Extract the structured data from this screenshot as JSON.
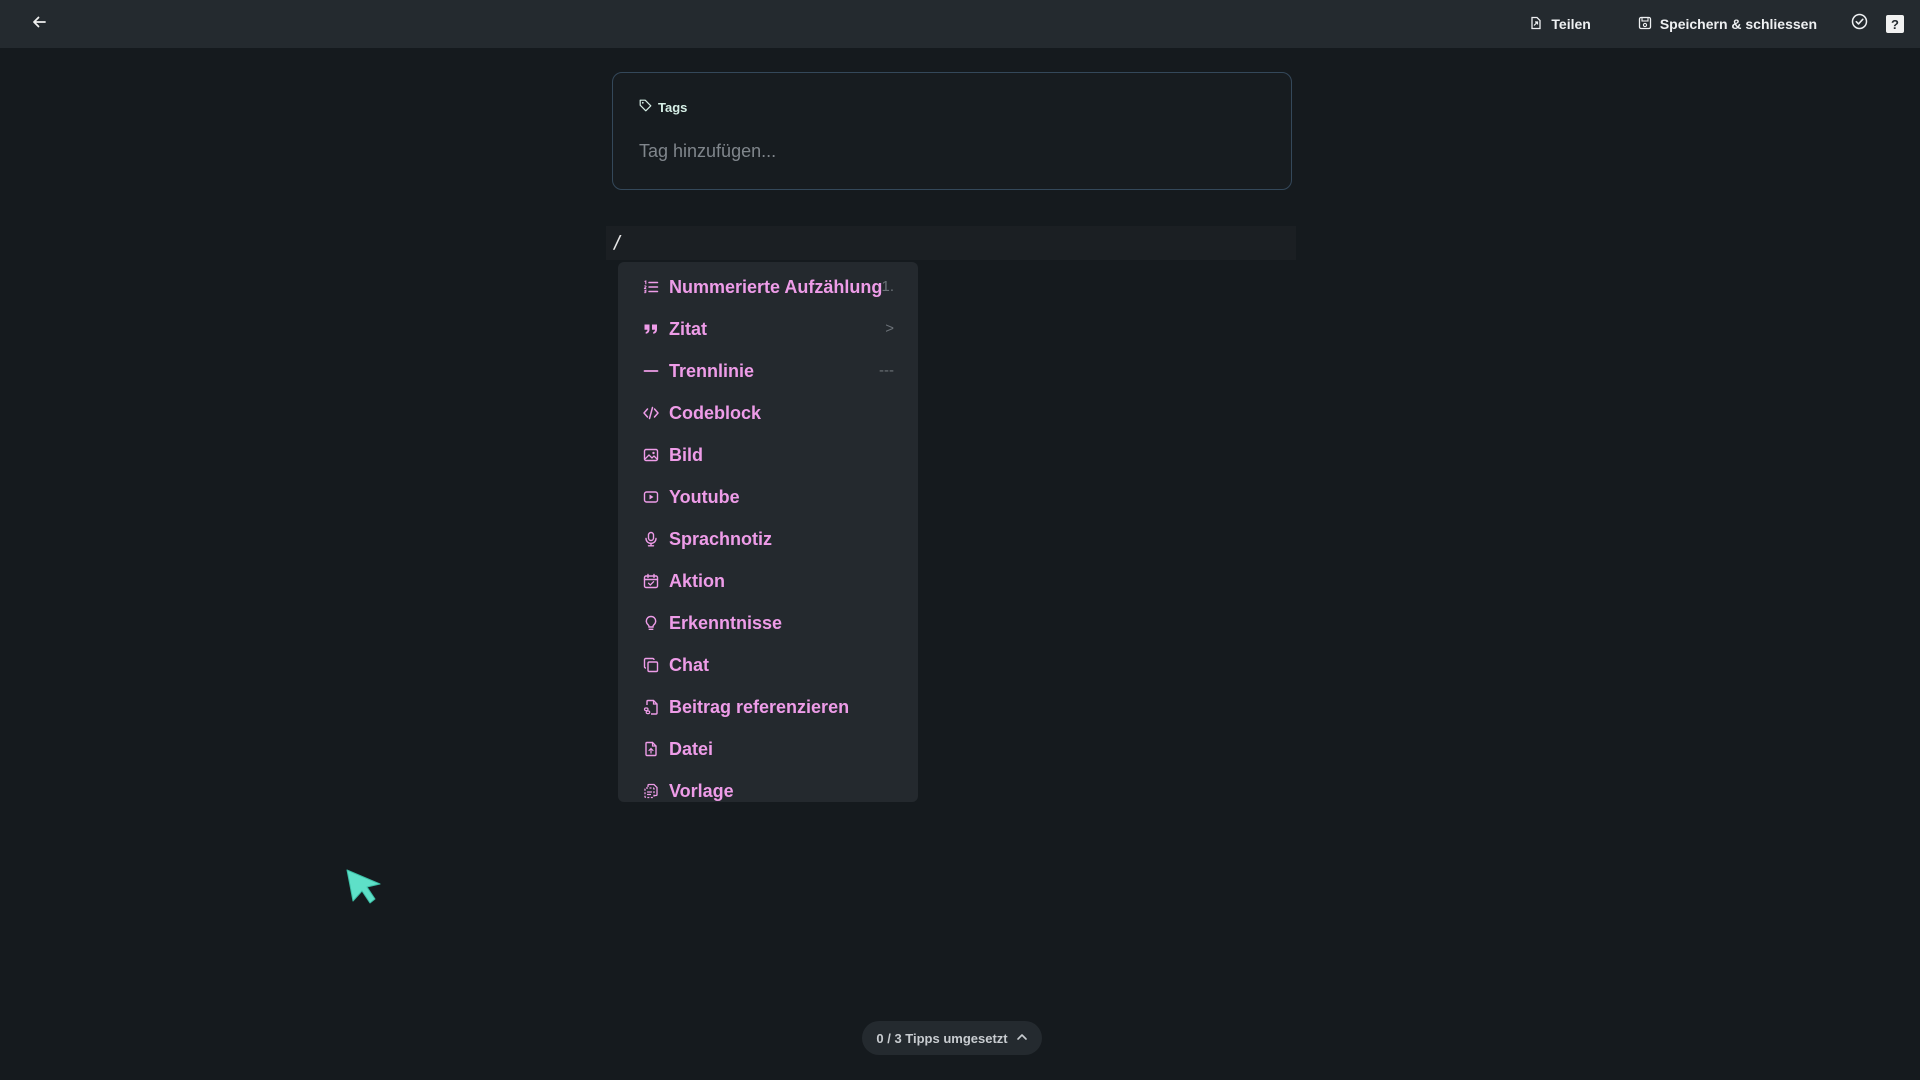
{
  "topbar": {
    "back_icon": "arrow-left-icon",
    "share_label": "Teilen",
    "save_close_label": "Speichern & schliessen",
    "check_icon": "check-circle-icon",
    "help_icon": "question-square-icon",
    "help_glyph": "?"
  },
  "tags": {
    "label": "Tags",
    "placeholder": "Tag hinzufügen..."
  },
  "editor": {
    "current_line": "/"
  },
  "slash_menu": {
    "accent_color": "#ee9ce8",
    "items": [
      {
        "label": "Nummerierte Aufzählung",
        "shortcut": "1.",
        "icon": "numbered-list-icon"
      },
      {
        "label": "Zitat",
        "shortcut": ">",
        "icon": "quote-icon"
      },
      {
        "label": "Trennlinie",
        "shortcut": "---",
        "icon": "divider-icon"
      },
      {
        "label": "Codeblock",
        "shortcut": "",
        "icon": "code-icon"
      },
      {
        "label": "Bild",
        "shortcut": "",
        "icon": "image-icon"
      },
      {
        "label": "Youtube",
        "shortcut": "",
        "icon": "youtube-icon"
      },
      {
        "label": "Sprachnotiz",
        "shortcut": "",
        "icon": "microphone-icon"
      },
      {
        "label": "Aktion",
        "shortcut": "",
        "icon": "calendar-check-icon"
      },
      {
        "label": "Erkenntnisse",
        "shortcut": "",
        "icon": "lightbulb-icon"
      },
      {
        "label": "Chat",
        "shortcut": "",
        "icon": "chat-copy-icon"
      },
      {
        "label": "Beitrag referenzieren",
        "shortcut": "",
        "icon": "document-link-icon"
      },
      {
        "label": "Datei",
        "shortcut": "",
        "icon": "file-icon"
      },
      {
        "label": "Vorlage",
        "shortcut": "",
        "icon": "template-icon"
      }
    ]
  },
  "tips": {
    "label": "0 / 3 Tipps umgesetzt",
    "chevron_icon": "chevron-up-icon"
  },
  "colors": {
    "background": "#151a1e",
    "topbar": "#242a2f",
    "menu_bg": "#24292e",
    "card_border": "#34485a",
    "cursor": "#5ee0c8"
  }
}
